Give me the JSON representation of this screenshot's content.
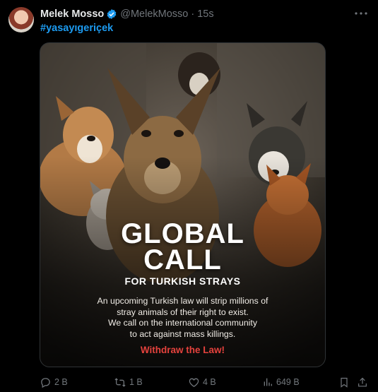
{
  "tweet": {
    "author_name": "Melek Mosso",
    "handle": "@MelekMosso",
    "separator": "·",
    "time": "15s",
    "hashtag": "#yasayıgeriçek"
  },
  "image": {
    "title_line1": "GLOBAL",
    "title_line2": "CALL",
    "subtitle": "FOR TURKISH STRAYS",
    "body_line1": "An upcoming Turkish law will strip millions of",
    "body_line2": "stray animals of their right to exist.",
    "body_line3": "We call on the international community",
    "body_line4": "to act against mass killings.",
    "cta": "Withdraw the Law!",
    "cta_color": "#e5423d"
  },
  "actions": {
    "replies": "2 B",
    "reposts": "1 B",
    "likes": "4 B",
    "views": "649 B"
  },
  "colors": {
    "background": "#000000",
    "accent": "#1d9bf0",
    "muted": "#71767b",
    "border": "#2f3336"
  },
  "icons": [
    "verified-badge-icon",
    "more-icon",
    "reply-icon",
    "repost-icon",
    "like-icon",
    "views-icon",
    "bookmark-icon",
    "share-icon"
  ]
}
